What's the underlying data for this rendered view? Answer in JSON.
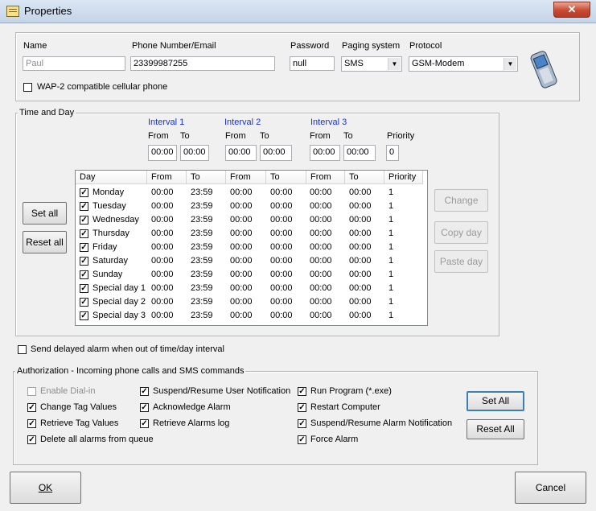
{
  "window": {
    "title": "Properties",
    "close_label": "✕"
  },
  "contact": {
    "name_label": "Name",
    "name_value": "Paul",
    "phone_label": "Phone Number/Email",
    "phone_value": "23399987255",
    "password_label": "Password",
    "password_value": "null",
    "paging_label": "Paging system",
    "paging_value": "SMS",
    "protocol_label": "Protocol",
    "protocol_value": "GSM-Modem",
    "wap_label": "WAP-2 compatible cellular phone",
    "wap_checked": false
  },
  "time_and_day": {
    "group_label": "Time and Day",
    "intervals": [
      {
        "label": "Interval 1",
        "from_label": "From",
        "to_label": "To",
        "from": "00:00",
        "to": "00:00"
      },
      {
        "label": "Interval 2",
        "from_label": "From",
        "to_label": "To",
        "from": "00:00",
        "to": "00:00"
      },
      {
        "label": "Interval 3",
        "from_label": "From",
        "to_label": "To",
        "from": "00:00",
        "to": "00:00"
      }
    ],
    "priority_label": "Priority",
    "priority_value": "0",
    "set_all": "Set all",
    "reset_all": "Reset all",
    "change": "Change",
    "copy_day": "Copy day",
    "paste_day": "Paste day",
    "columns": [
      "Day",
      "From",
      "To",
      "From",
      "To",
      "From",
      "To",
      "Priority"
    ],
    "rows": [
      {
        "day": "Monday",
        "checked": true,
        "f1": "00:00",
        "t1": "23:59",
        "f2": "00:00",
        "t2": "00:00",
        "f3": "00:00",
        "t3": "00:00",
        "p": "1"
      },
      {
        "day": "Tuesday",
        "checked": true,
        "f1": "00:00",
        "t1": "23:59",
        "f2": "00:00",
        "t2": "00:00",
        "f3": "00:00",
        "t3": "00:00",
        "p": "1"
      },
      {
        "day": "Wednesday",
        "checked": true,
        "f1": "00:00",
        "t1": "23:59",
        "f2": "00:00",
        "t2": "00:00",
        "f3": "00:00",
        "t3": "00:00",
        "p": "1"
      },
      {
        "day": "Thursday",
        "checked": true,
        "f1": "00:00",
        "t1": "23:59",
        "f2": "00:00",
        "t2": "00:00",
        "f3": "00:00",
        "t3": "00:00",
        "p": "1"
      },
      {
        "day": "Friday",
        "checked": true,
        "f1": "00:00",
        "t1": "23:59",
        "f2": "00:00",
        "t2": "00:00",
        "f3": "00:00",
        "t3": "00:00",
        "p": "1"
      },
      {
        "day": "Saturday",
        "checked": true,
        "f1": "00:00",
        "t1": "23:59",
        "f2": "00:00",
        "t2": "00:00",
        "f3": "00:00",
        "t3": "00:00",
        "p": "1"
      },
      {
        "day": "Sunday",
        "checked": true,
        "f1": "00:00",
        "t1": "23:59",
        "f2": "00:00",
        "t2": "00:00",
        "f3": "00:00",
        "t3": "00:00",
        "p": "1"
      },
      {
        "day": "Special day 1",
        "checked": true,
        "f1": "00:00",
        "t1": "23:59",
        "f2": "00:00",
        "t2": "00:00",
        "f3": "00:00",
        "t3": "00:00",
        "p": "1"
      },
      {
        "day": "Special day 2",
        "checked": true,
        "f1": "00:00",
        "t1": "23:59",
        "f2": "00:00",
        "t2": "00:00",
        "f3": "00:00",
        "t3": "00:00",
        "p": "1"
      },
      {
        "day": "Special day 3",
        "checked": true,
        "f1": "00:00",
        "t1": "23:59",
        "f2": "00:00",
        "t2": "00:00",
        "f3": "00:00",
        "t3": "00:00",
        "p": "1"
      }
    ]
  },
  "delayed_alarm": {
    "label": "Send delayed alarm when out of time/day interval",
    "checked": false
  },
  "authorization": {
    "group_label": "Authorization - Incoming phone calls and SMS commands",
    "items": [
      {
        "label": "Enable Dial-in",
        "checked": false,
        "disabled": true
      },
      {
        "label": "Change Tag Values",
        "checked": true
      },
      {
        "label": "Retrieve Tag Values",
        "checked": true
      },
      {
        "label": "Delete all alarms from queue",
        "checked": true
      },
      {
        "label": "Suspend/Resume User Notification",
        "checked": true
      },
      {
        "label": "Acknowledge Alarm",
        "checked": true
      },
      {
        "label": "Retrieve Alarms log",
        "checked": true
      },
      {
        "label": "Run Program (*.exe)",
        "checked": true
      },
      {
        "label": "Restart Computer",
        "checked": true
      },
      {
        "label": "Suspend/Resume Alarm Notification",
        "checked": true
      },
      {
        "label": "Force Alarm",
        "checked": true
      }
    ],
    "set_all": "Set All",
    "reset_all": "Reset All"
  },
  "footer": {
    "ok": "OK",
    "cancel": "Cancel"
  }
}
